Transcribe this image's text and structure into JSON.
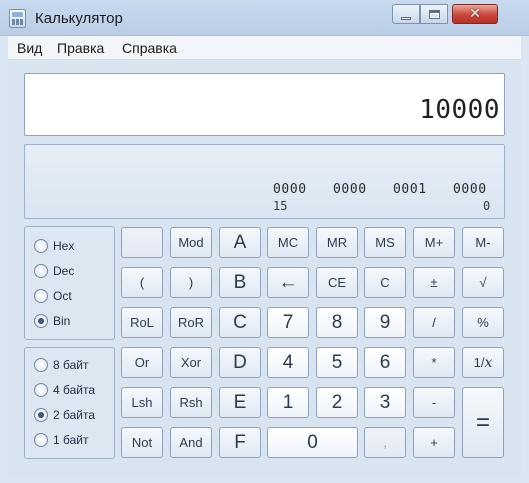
{
  "window": {
    "title": "Калькулятор",
    "controls": {
      "minimize": "minimize-icon",
      "maximize": "maximize-icon",
      "close": "close-icon"
    }
  },
  "menu": [
    "Вид",
    "Правка",
    "Справка"
  ],
  "display": {
    "value": "10000"
  },
  "bits": {
    "groups": [
      "0000",
      "0000",
      "0001",
      "0000"
    ],
    "pos_high": "15",
    "pos_low": "0"
  },
  "base_options": [
    "Hex",
    "Dec",
    "Oct",
    "Bin"
  ],
  "base_selected": "Bin",
  "word_options": [
    "8 байт",
    "4 байта",
    "2 байта",
    "1 байт"
  ],
  "word_selected": "2 байта",
  "keys": {
    "blank": "",
    "mod": "Mod",
    "a": "A",
    "mc": "MC",
    "mr": "MR",
    "ms": "MS",
    "mplus": "M+",
    "mminus": "M-",
    "lparen": "(",
    "rparen": ")",
    "b": "B",
    "backspace": "←",
    "ce": "CE",
    "c": "C",
    "plusminus": "±",
    "sqrt": "√",
    "rol": "RoL",
    "ror": "RoR",
    "cc": "C",
    "d7": "7",
    "d8": "8",
    "d9": "9",
    "div": "/",
    "pct": "%",
    "or": "Or",
    "xor": "Xor",
    "d": "D",
    "d4": "4",
    "d5": "5",
    "d6": "6",
    "mul": "*",
    "recip_1": "1/",
    "recip_x": "x",
    "lsh": "Lsh",
    "rsh": "Rsh",
    "e": "E",
    "d1": "1",
    "d2": "2",
    "d3": "3",
    "minus": "-",
    "equals": "=",
    "not": "Not",
    "and": "And",
    "f": "F",
    "d0": "0",
    "dot": ",",
    "plus": "+"
  }
}
